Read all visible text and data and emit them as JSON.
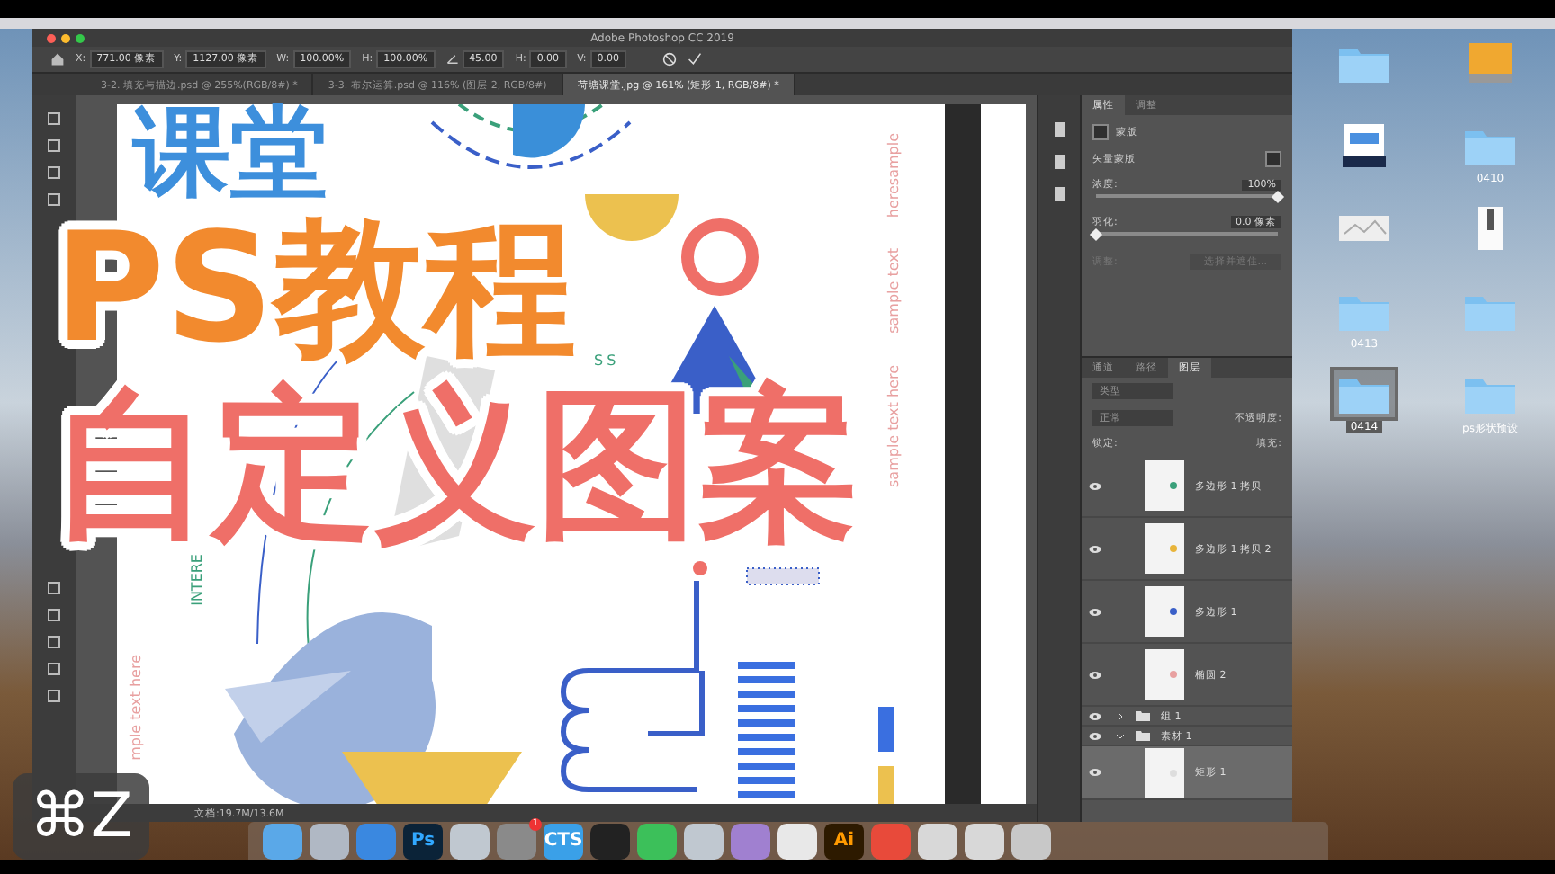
{
  "window": {
    "title": "Adobe Photoshop CC 2019"
  },
  "options_bar": {
    "fields": [
      {
        "kind": "text",
        "label": "X:",
        "value": "771.00 像素"
      },
      {
        "kind": "text",
        "label": "Y:",
        "value": "1127.00 像素"
      },
      {
        "kind": "text",
        "label": "W:",
        "value": "100.00%"
      },
      {
        "kind": "text",
        "label": "H:",
        "value": "100.00%"
      },
      {
        "kind": "angle",
        "value": "45.00"
      },
      {
        "kind": "text",
        "label": "H:",
        "value": "0.00"
      },
      {
        "kind": "text",
        "label": "V:",
        "value": "0.00"
      }
    ]
  },
  "tabs": [
    {
      "label": "3-2. 填充与描边.psd @ 255%(RGB/8#) *",
      "selected": false
    },
    {
      "label": "3-3. 布尔运算.psd @ 116% (图层 2, RGB/8#)",
      "selected": false
    },
    {
      "label": "荷塘课堂.jpg @ 161% (矩形 1, RGB/8#) *",
      "selected": true
    }
  ],
  "poster": {
    "right_texts": [
      "heresample",
      "sample text",
      "sample text here"
    ],
    "left_text": "mple text here",
    "arc_text": "INTERE",
    "arc_text_2": "SS"
  },
  "overlay": {
    "brand": "课堂",
    "title": "PS教程",
    "subtitle": "自定义图案"
  },
  "status_bar": {
    "document": "文档:19.7M/13.6M"
  },
  "properties": {
    "tabs": [
      {
        "label": "属性",
        "selected": true
      },
      {
        "label": "调整",
        "selected": false
      }
    ],
    "section": "蒙版",
    "mask_type": "矢量蒙版",
    "sliders": [
      {
        "label": "浓度:",
        "reading": "100%",
        "level": 1
      },
      {
        "label": "羽化:",
        "reading": "0.0 像素",
        "level": 0
      }
    ],
    "refine": {
      "label": "调整:",
      "button": "选择并遮住...",
      "disabled": true
    }
  },
  "layers": {
    "tabs": [
      {
        "label": "通道",
        "selected": false
      },
      {
        "label": "路径",
        "selected": false
      },
      {
        "label": "图层",
        "selected": true
      }
    ],
    "search": {
      "placeholder": "类型"
    },
    "blend_mode": "正常",
    "opacity_label": "不透明度:",
    "lock_label": "锁定:",
    "fill_label": "填充:",
    "items": [
      {
        "kind": "shape",
        "name": "多边形 1 拷贝",
        "visible": true,
        "selected": false,
        "color": "#3aa07a"
      },
      {
        "kind": "shape",
        "name": "多边形 1 拷贝 2",
        "visible": true,
        "selected": false,
        "color": "#e8b43a"
      },
      {
        "kind": "shape",
        "name": "多边形 1",
        "visible": true,
        "selected": false,
        "color": "#3a5fc8"
      },
      {
        "kind": "shape",
        "name": "椭圆 2",
        "visible": true,
        "selected": false,
        "color": "#e8a0a0"
      },
      {
        "kind": "group",
        "name": "组 1",
        "visible": true,
        "selected": false,
        "expanded": false
      },
      {
        "kind": "group",
        "name": "素材 1",
        "visible": true,
        "selected": false,
        "expanded": true,
        "children": [
          {
            "kind": "shape",
            "name": "矩形 1",
            "visible": true,
            "selected": true,
            "color": "#dddddd"
          }
        ]
      }
    ]
  },
  "desktop": {
    "icons": [
      {
        "kind": "folder",
        "selected": false
      },
      {
        "kind": "drive",
        "selected": false
      },
      {
        "kind": "gradient",
        "selected": false
      },
      {
        "kind": "folder",
        "label": "0410",
        "selected": false
      },
      {
        "kind": "image",
        "selected": false
      },
      {
        "kind": "zip",
        "selected": false
      },
      {
        "kind": "folder",
        "label": "0413",
        "selected": false
      },
      {
        "kind": "folder",
        "selected": false
      },
      {
        "kind": "folder",
        "label": "0414",
        "selected": true
      },
      {
        "kind": "folder",
        "label": "ps形状预设",
        "selected": false
      }
    ]
  },
  "dock": [
    {
      "kind": "finder"
    },
    {
      "kind": "rocket"
    },
    {
      "kind": "compass"
    },
    {
      "kind": "ps",
      "label": "Ps"
    },
    {
      "kind": "app"
    },
    {
      "kind": "gear",
      "badge": "1"
    },
    {
      "kind": "cts",
      "label": "CTS"
    },
    {
      "kind": "penguin"
    },
    {
      "kind": "chat"
    },
    {
      "kind": "app"
    },
    {
      "kind": "app"
    },
    {
      "kind": "app"
    },
    {
      "kind": "ai",
      "label": "Ai"
    },
    {
      "kind": "app"
    },
    {
      "kind": "stack"
    },
    {
      "kind": "stack"
    },
    {
      "kind": "trash"
    }
  ],
  "shortcut_badge": "⌘Z"
}
